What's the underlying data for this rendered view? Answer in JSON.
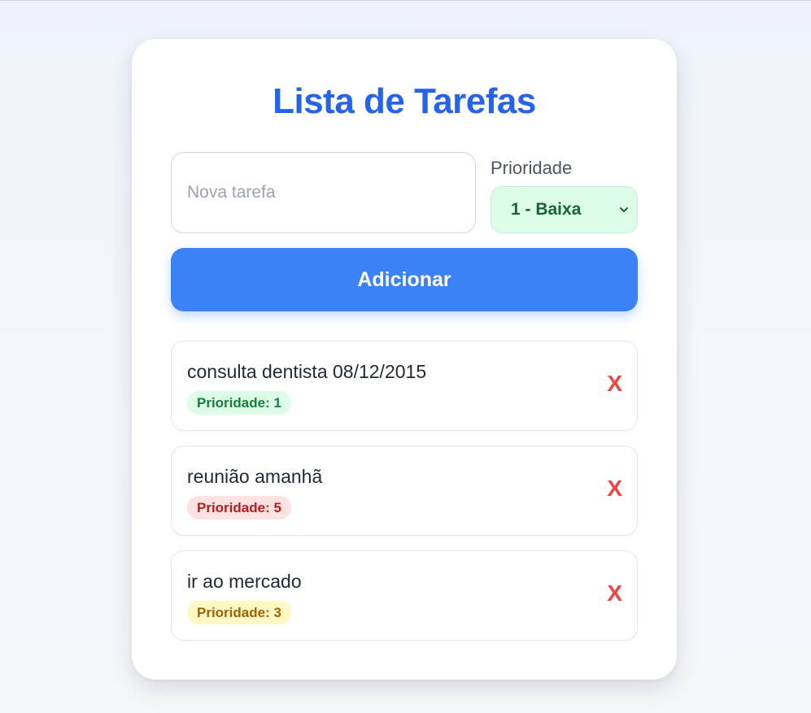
{
  "app": {
    "title": "Lista de Tarefas"
  },
  "form": {
    "task_input": {
      "placeholder": "Nova tarefa",
      "value": ""
    },
    "priority": {
      "label": "Prioridade",
      "selected": "1 - Baixa"
    },
    "add_button_label": "Adicionar"
  },
  "tasks": [
    {
      "text": "consulta dentista 08/12/2015",
      "priority_label": "Prioridade: 1",
      "priority": 1,
      "delete_label": "X"
    },
    {
      "text": "reunião amanhã",
      "priority_label": "Prioridade: 5",
      "priority": 5,
      "delete_label": "X"
    },
    {
      "text": "ir ao mercado",
      "priority_label": "Prioridade: 3",
      "priority": 3,
      "delete_label": "X"
    }
  ],
  "colors": {
    "accent": "#2563eb",
    "button": "#3b82f6",
    "delete": "#ef4444",
    "priority_low_bg": "#dcfce7",
    "priority_low_text": "#15803d",
    "priority_high_bg": "#fee2e2",
    "priority_high_text": "#b91c1c",
    "priority_mid_bg": "#fef9c3",
    "priority_mid_text": "#a16207"
  },
  "icons": {
    "select_arrow": "chevron-down-icon"
  }
}
